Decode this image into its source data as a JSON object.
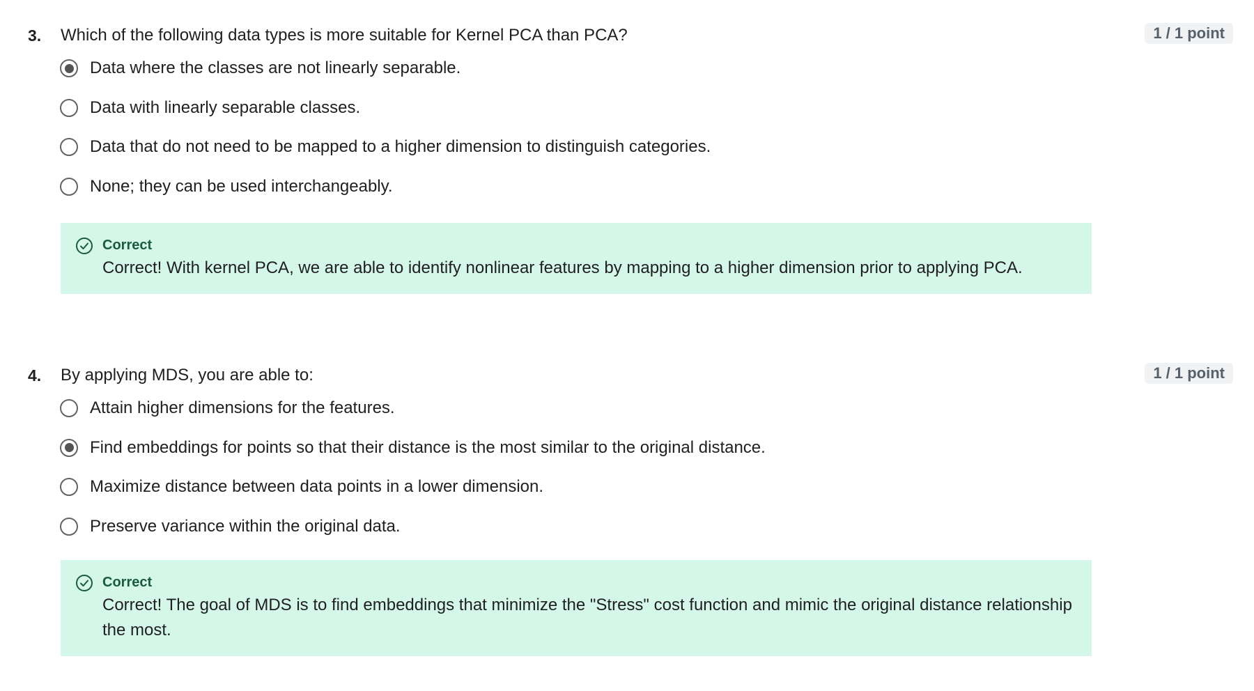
{
  "questions": [
    {
      "number": "3.",
      "text": "Which of the following data types is more suitable for Kernel PCA than PCA?",
      "points": "1 / 1 point",
      "options": [
        {
          "label": "Data where the classes are not linearly separable.",
          "selected": true
        },
        {
          "label": "Data with linearly separable classes.",
          "selected": false
        },
        {
          "label": "Data that do not need to be mapped to a higher dimension to distinguish categories.",
          "selected": false
        },
        {
          "label": "None; they can be used interchangeably.",
          "selected": false
        }
      ],
      "feedback": {
        "title": "Correct",
        "text": "Correct! With kernel PCA, we are able to identify nonlinear features by mapping to a higher dimension prior to applying PCA."
      }
    },
    {
      "number": "4.",
      "text": "By applying MDS, you are able to:",
      "points": "1 / 1 point",
      "options": [
        {
          "label": "Attain higher dimensions for the features.",
          "selected": false
        },
        {
          "label": "Find embeddings for points so that their distance is the most similar to the original distance.",
          "selected": true
        },
        {
          "label": "Maximize distance between data points in a lower dimension.",
          "selected": false
        },
        {
          "label": "Preserve variance within the original data.",
          "selected": false
        }
      ],
      "feedback": {
        "title": "Correct",
        "text": "Correct! The goal of MDS is to find embeddings that minimize the \"Stress\" cost function and mimic the original distance relationship the most."
      }
    }
  ],
  "colors": {
    "feedback_background": "#d5f7ea",
    "feedback_title": "#1a5a43",
    "points_badge_background": "#f0f2f4",
    "points_badge_text": "#56606b"
  },
  "icons": {
    "feedback": "check-circle-icon"
  }
}
